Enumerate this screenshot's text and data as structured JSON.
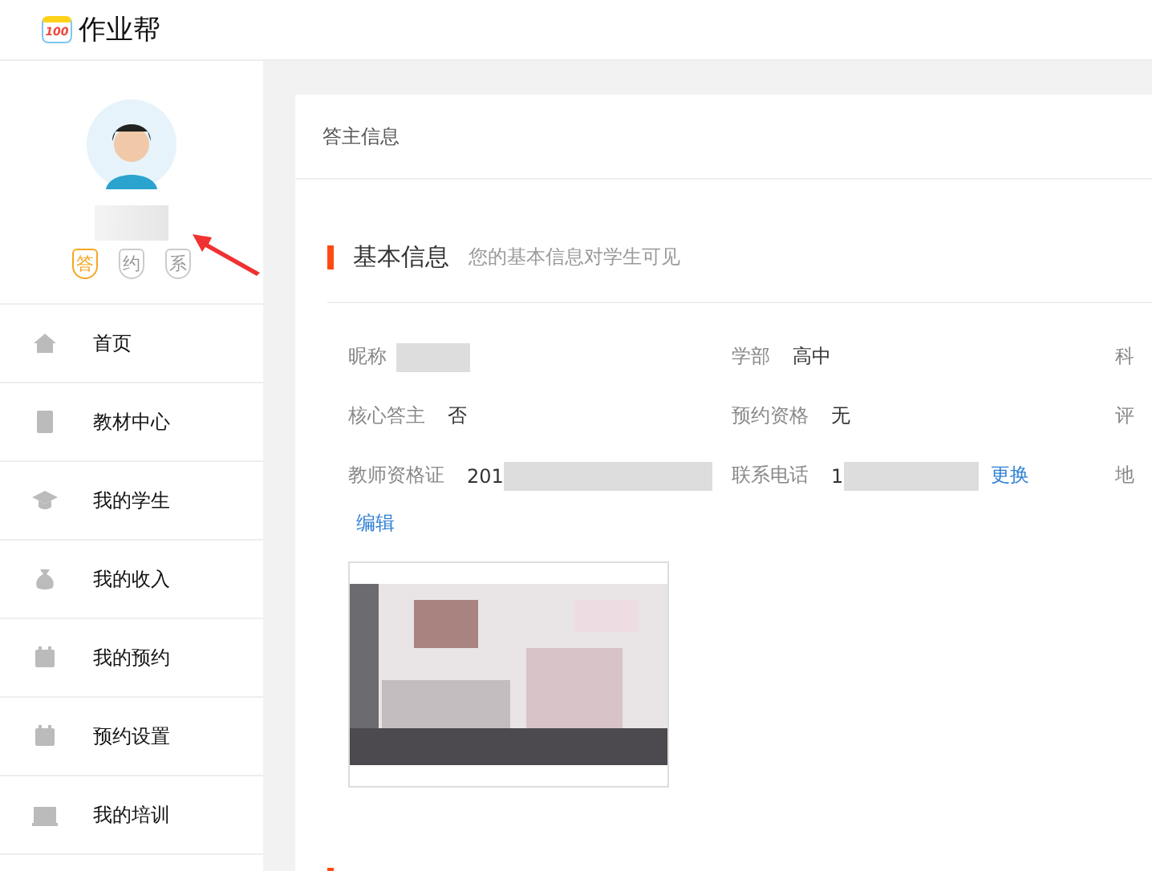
{
  "header": {
    "logo_badge": "100",
    "brand": "作业帮"
  },
  "profile": {
    "badges": [
      {
        "label": "答",
        "active": true
      },
      {
        "label": "约",
        "active": false
      },
      {
        "label": "系",
        "active": false
      }
    ]
  },
  "menu": [
    {
      "label": "首页",
      "kind": "home"
    },
    {
      "label": "教材中心",
      "kind": "book"
    },
    {
      "label": "我的学生",
      "kind": "cap"
    },
    {
      "label": "我的收入",
      "kind": "moneybag"
    },
    {
      "label": "我的预约",
      "kind": "calendar"
    },
    {
      "label": "预约设置",
      "kind": "calcheck"
    },
    {
      "label": "我的培训",
      "kind": "board"
    }
  ],
  "card": {
    "title": "答主信息",
    "section": {
      "title": "基本信息",
      "hint": "您的基本信息对学生可见"
    },
    "rows": [
      [
        {
          "label": "昵称",
          "blurred": true
        },
        {
          "label": "学部",
          "value": "高中"
        },
        {
          "label": "科"
        }
      ],
      [
        {
          "label": "核心答主",
          "value": "否"
        },
        {
          "label": "预约资格",
          "value": "无"
        },
        {
          "label": "评"
        }
      ],
      [
        {
          "label": "教师资格证",
          "value": "201",
          "blurred": true
        },
        {
          "label": "联系电话",
          "value": "1",
          "blurred": true,
          "link": "更换"
        },
        {
          "label": "地"
        }
      ]
    ],
    "edit_link": "编辑"
  }
}
